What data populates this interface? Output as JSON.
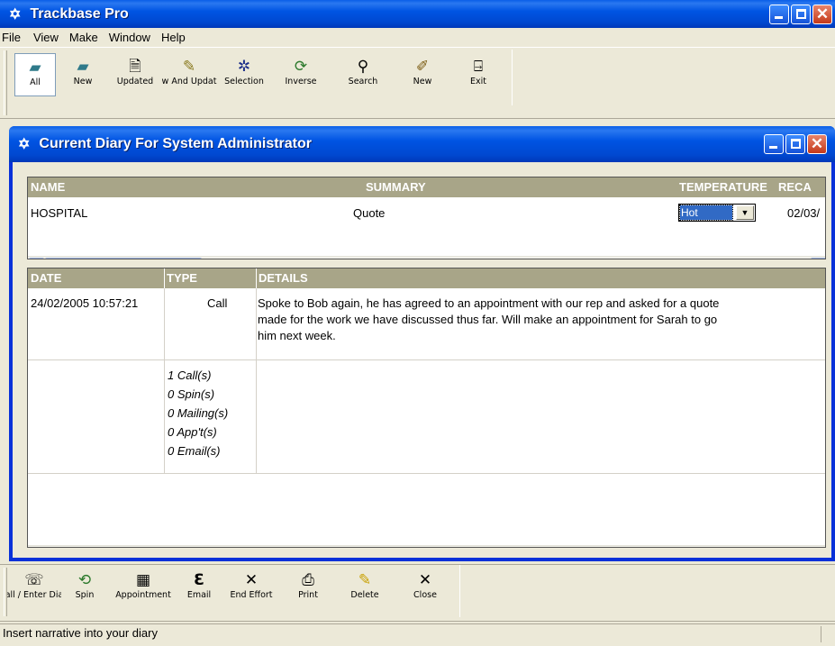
{
  "app": {
    "title": "Trackbase Pro"
  },
  "menu": [
    "File",
    "View",
    "Make",
    "Window",
    "Help"
  ],
  "top_toolbar": [
    {
      "label": "All",
      "icon": "folder-icon"
    },
    {
      "label": "New",
      "icon": "new-folder-icon"
    },
    {
      "label": "Updated",
      "icon": "updated-icon"
    },
    {
      "label": "w And Updat",
      "icon": "new-and-updated-icon"
    },
    {
      "label": "Selection",
      "icon": "selection-icon"
    },
    {
      "label": "Inverse",
      "icon": "inverse-icon"
    },
    {
      "label": "Search",
      "icon": "search-icon"
    },
    {
      "label": "New",
      "icon": "new-item-icon"
    },
    {
      "label": "Exit",
      "icon": "exit-door-icon"
    }
  ],
  "diary": {
    "title": "Current Diary For System Administrator",
    "contact": {
      "headers": {
        "name": "NAME",
        "summary": "SUMMARY",
        "temperature": "TEMPERATURE",
        "recall": "RECA"
      },
      "row": {
        "name": "HOSPITAL",
        "summary": "Quote",
        "temperature": "Hot",
        "recall": "02/03/"
      }
    },
    "log": {
      "headers": {
        "date": "DATE",
        "type": "TYPE",
        "details": "DETAILS"
      },
      "rows": [
        {
          "date": "24/02/2005 10:57:21",
          "type": "Call",
          "details_lines": [
            "Spoke to Bob again, he has agreed to an appointment with our rep and asked for a quote",
            "made for the work we have discussed thus far. Will make an appointment for Sarah to go",
            "him next week."
          ]
        }
      ],
      "totals": [
        "1 Call(s)",
        "0 Spin(s)",
        "0 Mailing(s)",
        "0 App't(s)",
        "0 Email(s)"
      ]
    }
  },
  "bottom_toolbar": [
    {
      "label": "all / Enter Dia",
      "icon": "telephone-icon"
    },
    {
      "label": "Spin",
      "icon": "spin-icon"
    },
    {
      "label": "Appointment",
      "icon": "calendar-icon"
    },
    {
      "label": "Email",
      "icon": "email-icon"
    },
    {
      "label": "End Effort",
      "icon": "end-effort-x-icon"
    },
    {
      "label": "Print",
      "icon": "printer-icon"
    },
    {
      "label": "Delete",
      "icon": "eraser-icon"
    },
    {
      "label": "Close",
      "icon": "close-x-icon"
    }
  ],
  "status": "Insert narrative into your diary",
  "colors": {
    "title_bar": "#0054e3",
    "grid_header": "#a8a588",
    "dialog_frame": "#0831d9",
    "chrome": "#ece9d8"
  }
}
